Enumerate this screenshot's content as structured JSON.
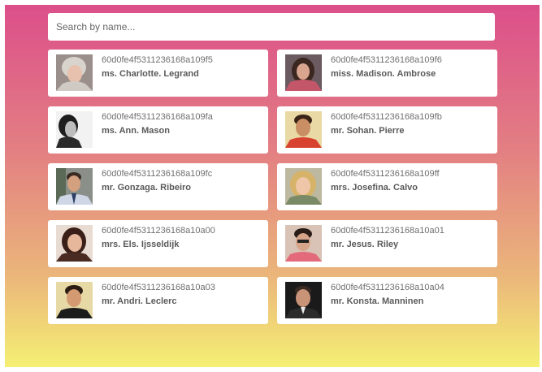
{
  "search": {
    "placeholder": "Search by name...",
    "value": ""
  },
  "colors": {
    "gradient_top": "#dc4f8a",
    "gradient_bottom": "#f5f074",
    "card_background": "#ffffff"
  },
  "users": [
    {
      "id": "60d0fe4f5311236168a109f5",
      "name": "ms. Charlotte. Legrand",
      "avatar": "avatar-0"
    },
    {
      "id": "60d0fe4f5311236168a109f6",
      "name": "miss. Madison. Ambrose",
      "avatar": "avatar-1"
    },
    {
      "id": "60d0fe4f5311236168a109fa",
      "name": "ms. Ann. Mason",
      "avatar": "avatar-2"
    },
    {
      "id": "60d0fe4f5311236168a109fb",
      "name": "mr. Sohan. Pierre",
      "avatar": "avatar-3"
    },
    {
      "id": "60d0fe4f5311236168a109fc",
      "name": "mr. Gonzaga. Ribeiro",
      "avatar": "avatar-4"
    },
    {
      "id": "60d0fe4f5311236168a109ff",
      "name": "mrs. Josefina. Calvo",
      "avatar": "avatar-5"
    },
    {
      "id": "60d0fe4f5311236168a10a00",
      "name": "mrs. Els. Ijsseldijk",
      "avatar": "avatar-6"
    },
    {
      "id": "60d0fe4f5311236168a10a01",
      "name": "mr. Jesus. Riley",
      "avatar": "avatar-7"
    },
    {
      "id": "60d0fe4f5311236168a10a03",
      "name": "mr. Andri. Leclerc",
      "avatar": "avatar-8"
    },
    {
      "id": "60d0fe4f5311236168a10a04",
      "name": "mr. Konsta. Manninen",
      "avatar": "avatar-9"
    }
  ]
}
